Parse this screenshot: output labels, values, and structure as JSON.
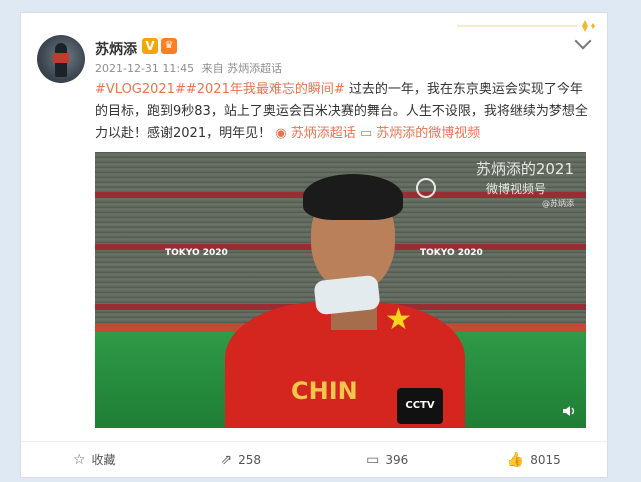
{
  "post": {
    "author": "苏炳添",
    "verified_badge": "V",
    "level_badge": "♛",
    "timestamp": "2021-12-31 11:45",
    "source": "来自 苏炳添超话",
    "topics": [
      "#VLOG2021#",
      "#2021年我最难忘的瞬间#"
    ],
    "text": " 过去的一年，我在东京奥运会实现了今年的目标，跑到9秒83，站上了奥运会百米决赛的舞台。人生不设限，我将继续为梦想全力以赴！感谢2021，明年见！",
    "link1": "苏炳添超话",
    "link2": "苏炳添的微博视频"
  },
  "video": {
    "watermark_title": "苏炳添的2021",
    "watermark_sub": "微博视频号",
    "watermark_handle": "@苏炳添",
    "stadium_banner_1": "TOKYO 2020",
    "stadium_banner_2": "TOKYO 2020",
    "shirt_text": "CHIN",
    "mic_logo": "CCTV"
  },
  "actions": {
    "favorite_label": "收藏",
    "repost_count": "258",
    "comment_count": "396",
    "like_count": "8015"
  },
  "colors": {
    "accent": "#eb7350",
    "page_bg": "#dfe9f3"
  }
}
